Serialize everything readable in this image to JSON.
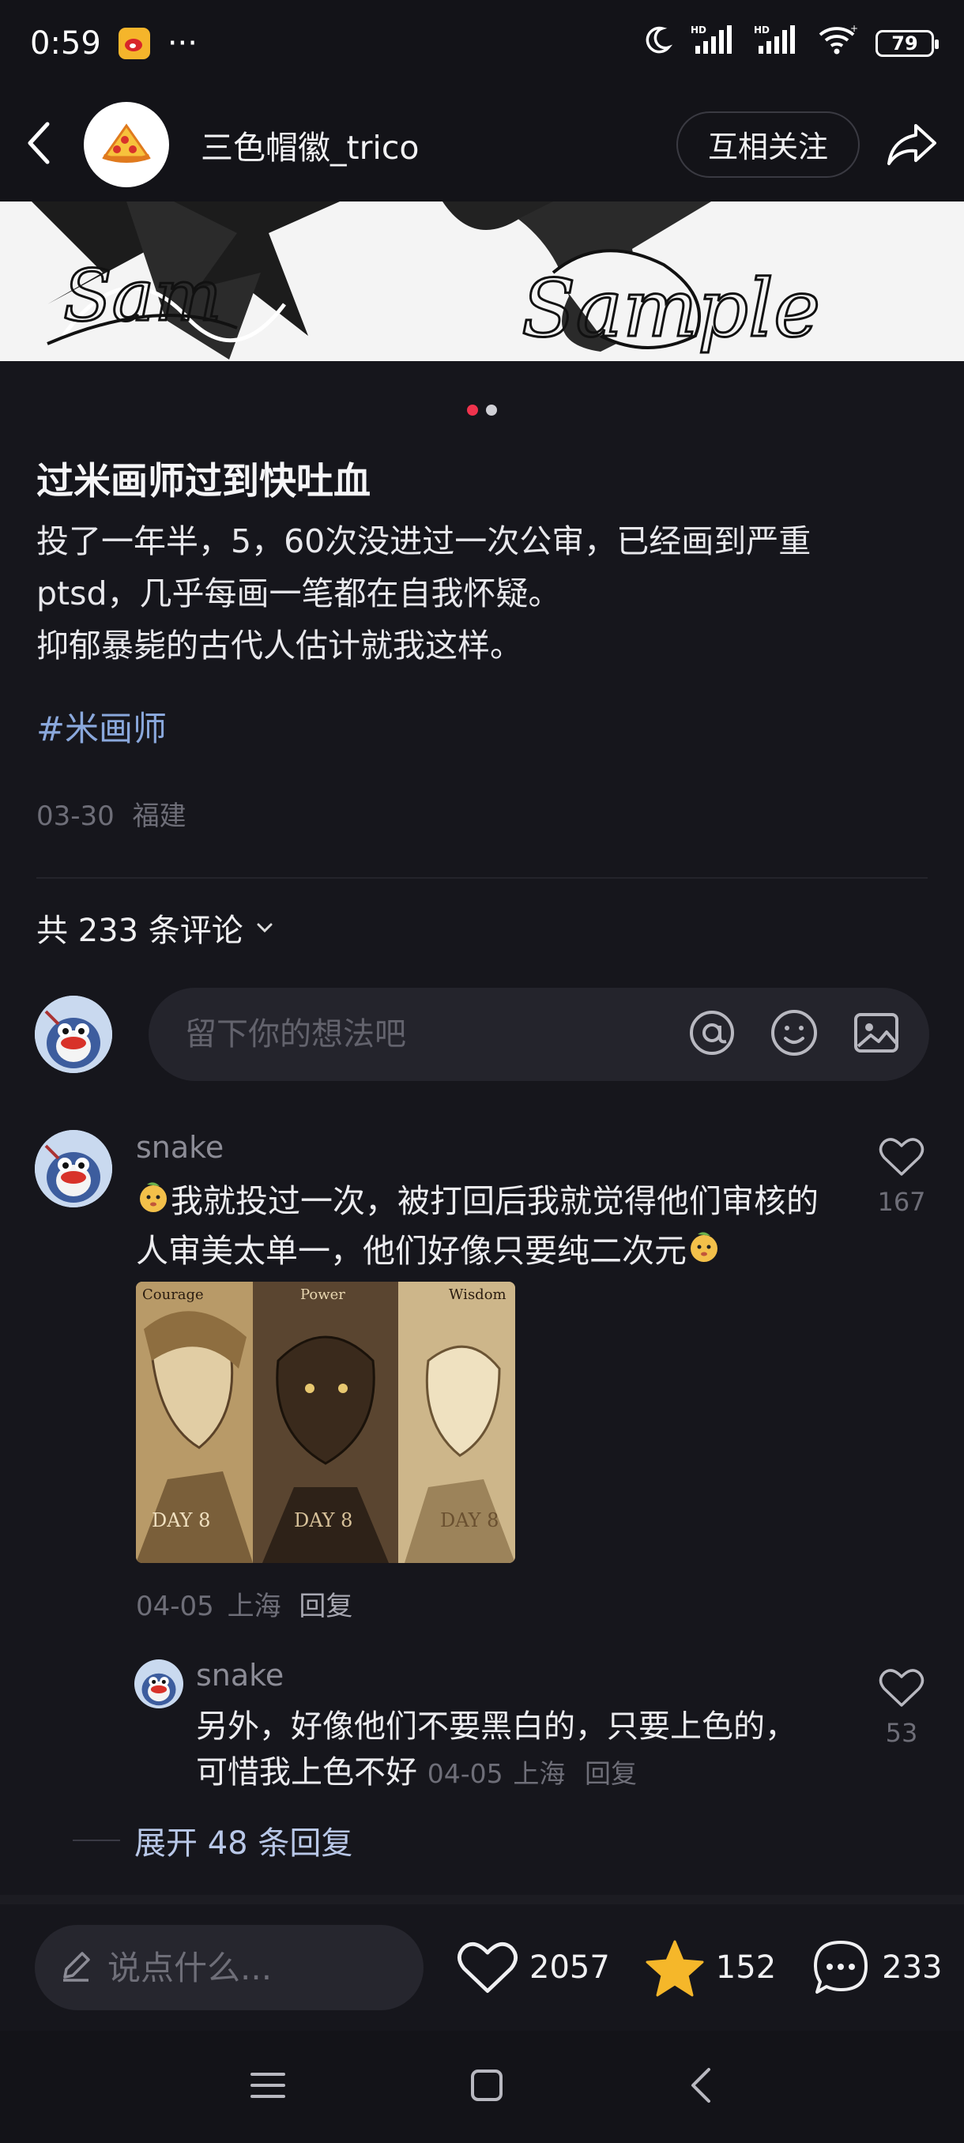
{
  "status_bar": {
    "time": "0:59",
    "more": "···",
    "battery": "79",
    "icons": [
      "weibo-icon",
      "moon-icon",
      "hd-signal-icon",
      "hd-signal-icon",
      "wifi-icon",
      "battery-icon"
    ]
  },
  "header": {
    "username": "三色帽徽_trico",
    "follow_label": "互相关注",
    "icons": [
      "back-arrow-icon",
      "pizza-avatar",
      "share-icon"
    ]
  },
  "carousel": {
    "total": 2,
    "active_index": 0,
    "accent": "#f0334d"
  },
  "post": {
    "title": "过米画师过到快吐血",
    "body_lines": [
      "投了一年半，5，60次没进过一次公审，已经画到严重",
      "ptsd，几乎每画一笔都在自我怀疑。",
      "抑郁暴毙的古代人估计就我这样。"
    ],
    "hashtag": "#米画师",
    "date": "03-30",
    "location": "福建"
  },
  "comments_section": {
    "count_label": "共 233 条评论",
    "input_placeholder": "留下你的想法吧"
  },
  "comments": [
    {
      "username": "snake",
      "text_lines": [
        "我就投过一次，被打回后我就觉得他们审核的",
        "人审美太单一，他们好像只要纯二次元"
      ],
      "likes": "167",
      "image_labels": [
        "Courage",
        "Power",
        "Wisdom"
      ],
      "image_caption": "DAY 8",
      "date": "04-05",
      "location": "上海",
      "reply_label": "回复"
    }
  ],
  "replies": [
    {
      "username": "snake",
      "text_lines": [
        "另外，好像他们不要黑白的，只要上色的，",
        "可惜我上色不好"
      ],
      "likes": "53",
      "date": "04-05",
      "location": "上海",
      "reply_label": "回复"
    }
  ],
  "expand_label": "展开 48 条回复",
  "bottom_bar": {
    "say_placeholder": "说点什么...",
    "likes": "2057",
    "favorites": "152",
    "comments": "233",
    "star_color": "#f5b72a"
  }
}
